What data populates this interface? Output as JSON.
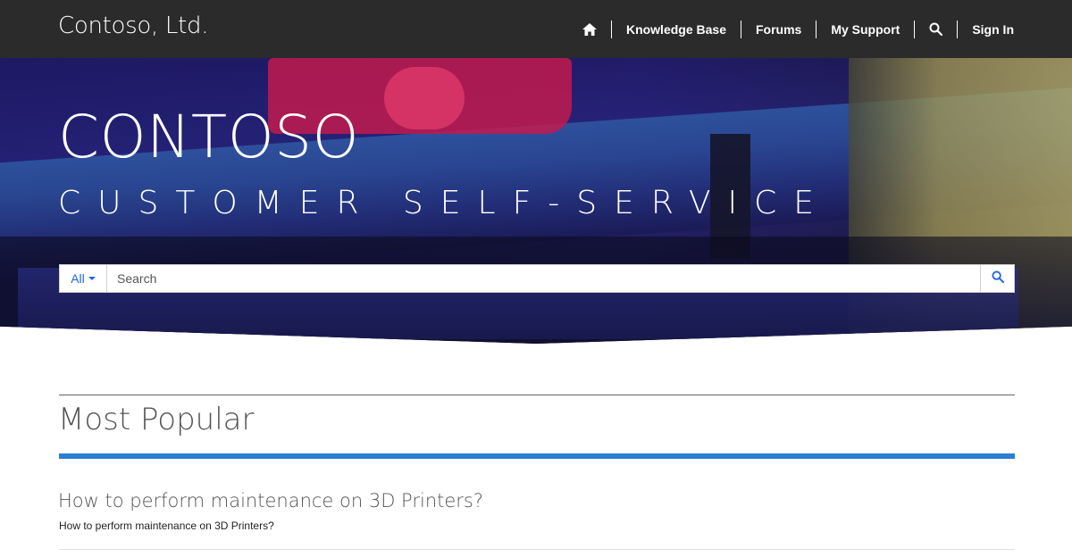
{
  "header": {
    "brand": "Contoso, Ltd.",
    "nav": {
      "home_icon": "home-icon",
      "knowledge_base": "Knowledge Base",
      "forums": "Forums",
      "my_support": "My Support",
      "search_icon": "search-icon",
      "sign_in": "Sign In"
    }
  },
  "hero": {
    "title": "CONTOSO",
    "subtitle": "CUSTOMER SELF-SERVICE",
    "search": {
      "scope": "All",
      "placeholder": "Search",
      "button_icon": "search-icon"
    }
  },
  "main": {
    "section_title": "Most Popular",
    "articles": [
      {
        "title": "How to perform maintenance on 3D Printers?",
        "description": "How to perform maintenance on 3D Printers?"
      }
    ]
  },
  "colors": {
    "topbar": "#2b2b2b",
    "accent_blue": "#2a7fd4",
    "link_blue": "#2266e3"
  }
}
